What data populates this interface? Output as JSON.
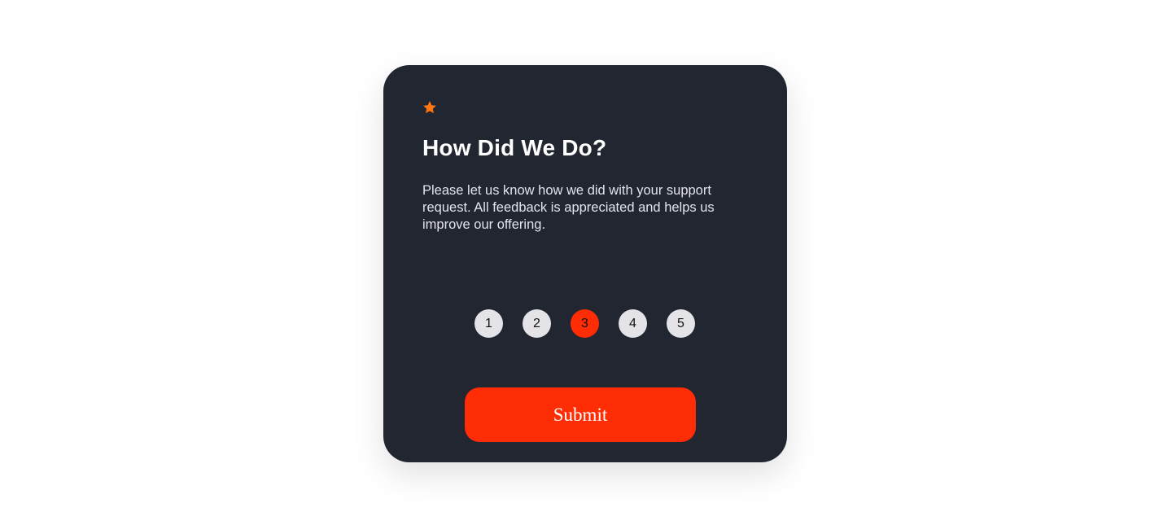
{
  "card": {
    "icon": "star-icon",
    "title": "How Did We Do?",
    "description": "Please let us know how we did with your support request. All feedback is appreciated and helps us improve our offering.",
    "ratings": [
      "1",
      "2",
      "3",
      "4",
      "5"
    ],
    "selected_rating": "3",
    "submit_label": "Submit"
  },
  "colors": {
    "card_background": "#212631",
    "accent": "#fe2d05",
    "star": "#fc7614",
    "rating_background": "#e3e3e8"
  }
}
